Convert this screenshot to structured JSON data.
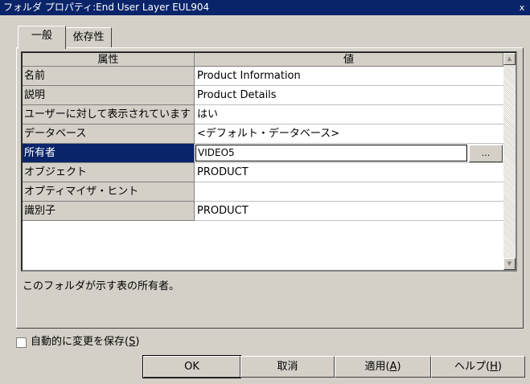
{
  "window": {
    "title": "フォルダ プロパティ:End User Layer  EUL904",
    "close_glyph": "x"
  },
  "tabs": [
    {
      "label": "一般"
    },
    {
      "label": "依存性"
    }
  ],
  "grid": {
    "headers": {
      "property": "属性",
      "value": "値"
    },
    "rows": [
      {
        "name": "名前",
        "value": "Product Information"
      },
      {
        "name": "説明",
        "value": "Product Details"
      },
      {
        "name": "ユーザーに対して表示されています",
        "value": "はい"
      },
      {
        "name": "データベース",
        "value": "<デフォルト・データベース>"
      },
      {
        "name": "所有者",
        "value": "VIDEO5"
      },
      {
        "name": "オブジェクト",
        "value": "PRODUCT"
      },
      {
        "name": "オプティマイザ・ヒント",
        "value": ""
      },
      {
        "name": "識別子",
        "value": "PRODUCT"
      }
    ],
    "browse_label": "...",
    "scroll_up": "▲",
    "scroll_down": "▼"
  },
  "description": "このフォルダが示す表の所有者。",
  "autosave": {
    "label": "自動的に変更を保存",
    "mnemonic": "S",
    "checked": false
  },
  "buttons": {
    "ok": "OK",
    "cancel": "取消",
    "apply": "適用",
    "apply_mnemonic": "A",
    "help": "ヘルプ",
    "help_mnemonic": "H"
  },
  "colors": {
    "titlebar": "#0a246a",
    "face": "#d4d0c8",
    "selection": "#0a246a"
  }
}
